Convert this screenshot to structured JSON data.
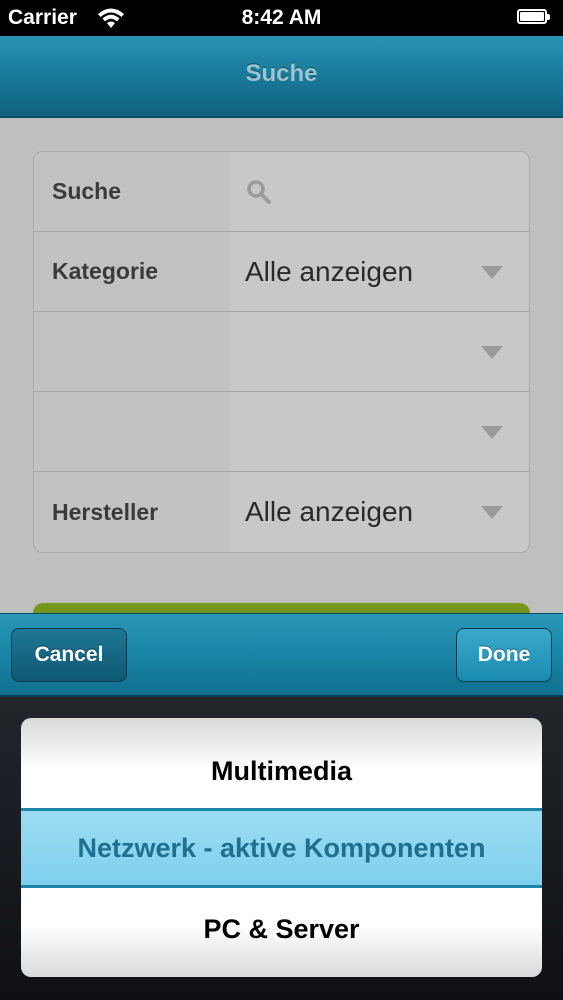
{
  "status_bar": {
    "carrier": "Carrier",
    "time": "8:42 AM",
    "battery_level": 1.0
  },
  "nav": {
    "title": "Suche"
  },
  "form": {
    "rows": [
      {
        "label": "Suche",
        "value": "",
        "icon": "search-icon"
      },
      {
        "label": "Kategorie",
        "value": "Alle anzeigen"
      },
      {
        "label": "",
        "value": ""
      },
      {
        "label": "",
        "value": ""
      },
      {
        "label": "Hersteller",
        "value": "Alle anzeigen"
      }
    ]
  },
  "toolbar": {
    "cancel_label": "Cancel",
    "done_label": "Done"
  },
  "picker": {
    "items": [
      "Multimedia",
      "Netzwerk - aktive Komponenten",
      "PC & Server"
    ],
    "selected": "Netzwerk - aktive Komponenten"
  },
  "colors": {
    "nav_bar": "#1a7c9c",
    "picker_selection": "#8ed6f0",
    "green_button": "#6b8a17"
  }
}
